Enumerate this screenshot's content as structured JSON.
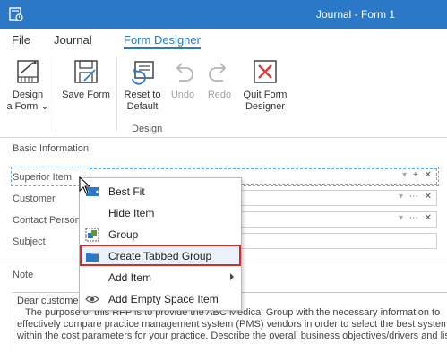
{
  "window": {
    "title": "Journal - Form 1"
  },
  "menu": {
    "tabs": [
      "File",
      "Journal",
      "Form Designer"
    ],
    "active_tab": "Form Designer"
  },
  "ribbon": {
    "design_form": {
      "line1": "Design",
      "line2": "a Form"
    },
    "save_form": {
      "line1": "Save Form"
    },
    "reset": {
      "line1": "Reset to",
      "line2": "Default"
    },
    "undo": {
      "line1": "Undo"
    },
    "redo": {
      "line1": "Redo"
    },
    "quit": {
      "line1": "Quit Form",
      "line2": "Designer"
    },
    "group_label": "Design"
  },
  "form": {
    "section_title": "Basic Information",
    "fields": {
      "superior_item": "Superior Item",
      "customer": "Customer",
      "contact_person": "Contact Person",
      "subject": "Subject"
    },
    "note_label": "Note",
    "note_text": {
      "line1": "Dear customer,",
      "line2": "   The purpose of this RFP is to provide the ABC Medical Group with the necessary information to",
      "line3": "effectively compare practice management system (PMS) vendors in order to select the best system",
      "line4": "within the cost parameters for your practice. Describe the overall business objectives/drivers and list"
    }
  },
  "context_menu": {
    "items": [
      {
        "label": "Best Fit",
        "icon": "best-fit-icon"
      },
      {
        "label": "Hide Item",
        "icon": ""
      },
      {
        "label": "Group",
        "icon": "group-icon"
      },
      {
        "label": "Create Tabbed Group",
        "icon": "folder-icon",
        "highlighted": true
      },
      {
        "label": "Add Item",
        "icon": "",
        "submenu": true
      },
      {
        "label": "Add Empty Space Item",
        "icon": "eye-icon"
      }
    ]
  },
  "colors": {
    "accent": "#2b79c6",
    "highlight_outline": "#d42b2b",
    "quit_red": "#e23b3b"
  }
}
